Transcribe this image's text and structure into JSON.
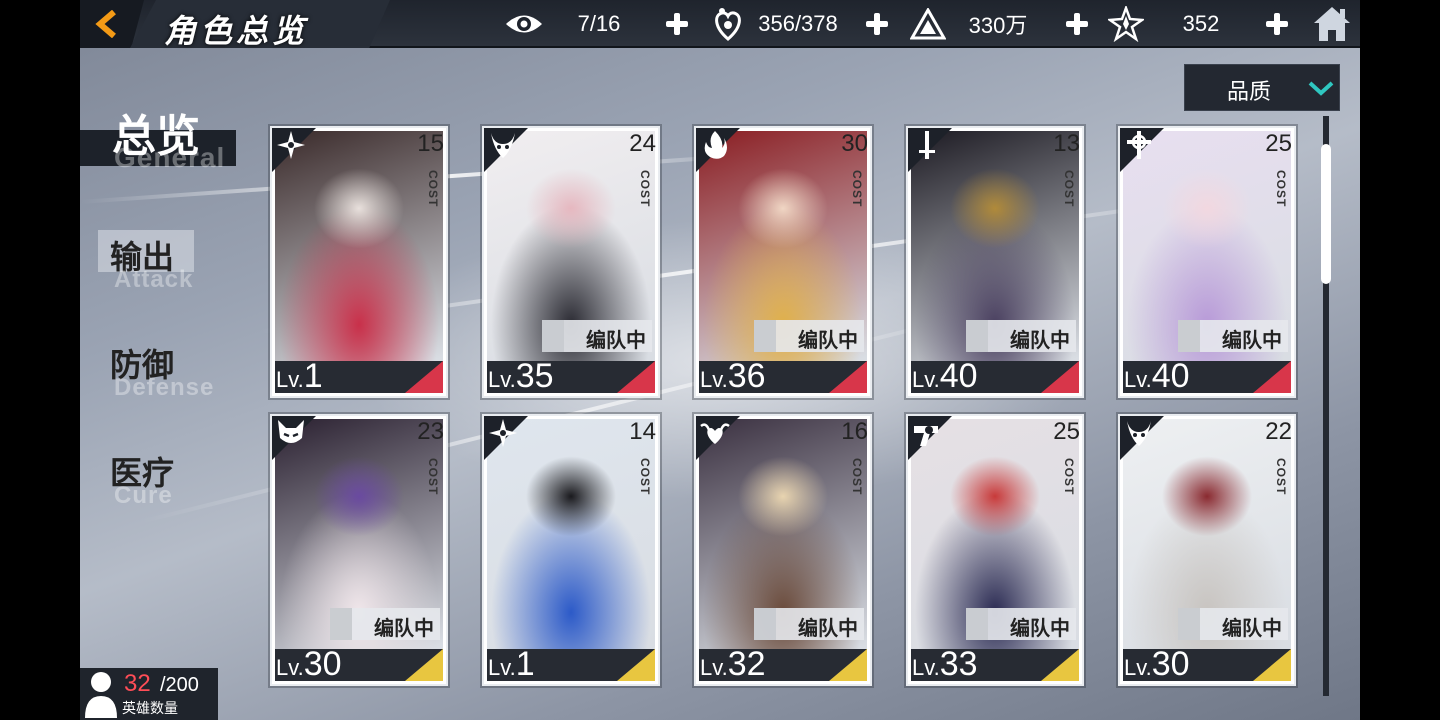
{
  "header": {
    "title": "角色总览"
  },
  "resources": [
    {
      "icon": "eye-icon",
      "value": "7/16"
    },
    {
      "icon": "stamina-heart-icon",
      "value": "356/378"
    },
    {
      "icon": "gold-pyramid-icon",
      "value": "330万"
    },
    {
      "icon": "star-crystal-icon",
      "value": "352"
    }
  ],
  "sort": {
    "label": "品质"
  },
  "nav": {
    "active": {
      "cn": "总览",
      "en": "General"
    },
    "items": [
      {
        "cn": "输出",
        "en": "Attack"
      },
      {
        "cn": "防御",
        "en": "Defense"
      },
      {
        "cn": "医疗",
        "en": "Cure"
      }
    ]
  },
  "card_texts": {
    "cost": "COST",
    "lv_prefix": "Lv.",
    "team": "编队中"
  },
  "cards": [
    {
      "cost": "15",
      "level": "1",
      "in_team": false,
      "class_icon": "shuriken-icon",
      "rarity_color": "#d8364a"
    },
    {
      "cost": "24",
      "level": "35",
      "in_team": true,
      "class_icon": "demon-horns-icon",
      "rarity_color": "#d8364a"
    },
    {
      "cost": "30",
      "level": "36",
      "in_team": true,
      "class_icon": "flame-icon",
      "rarity_color": "#d8364a"
    },
    {
      "cost": "13",
      "level": "40",
      "in_team": true,
      "class_icon": "sword-icon",
      "rarity_color": "#d8364a"
    },
    {
      "cost": "25",
      "level": "40",
      "in_team": true,
      "class_icon": "holy-cross-icon",
      "rarity_color": "#d8364a"
    },
    {
      "cost": "23",
      "level": "30",
      "in_team": true,
      "class_icon": "fox-mask-icon",
      "rarity_color": "#e8c640"
    },
    {
      "cost": "14",
      "level": "1",
      "in_team": false,
      "class_icon": "shuriken-icon",
      "rarity_color": "#e8c640"
    },
    {
      "cost": "16",
      "level": "32",
      "in_team": true,
      "class_icon": "winged-heart-icon",
      "rarity_color": "#e8c640"
    },
    {
      "cost": "25",
      "level": "33",
      "in_team": true,
      "class_icon": "revolver-icon",
      "rarity_color": "#e8c640"
    },
    {
      "cost": "22",
      "level": "30",
      "in_team": true,
      "class_icon": "demon-horns-icon",
      "rarity_color": "#e8c640"
    }
  ],
  "hero_count": {
    "current": "32",
    "max": "/200",
    "label": "英雄数量"
  }
}
